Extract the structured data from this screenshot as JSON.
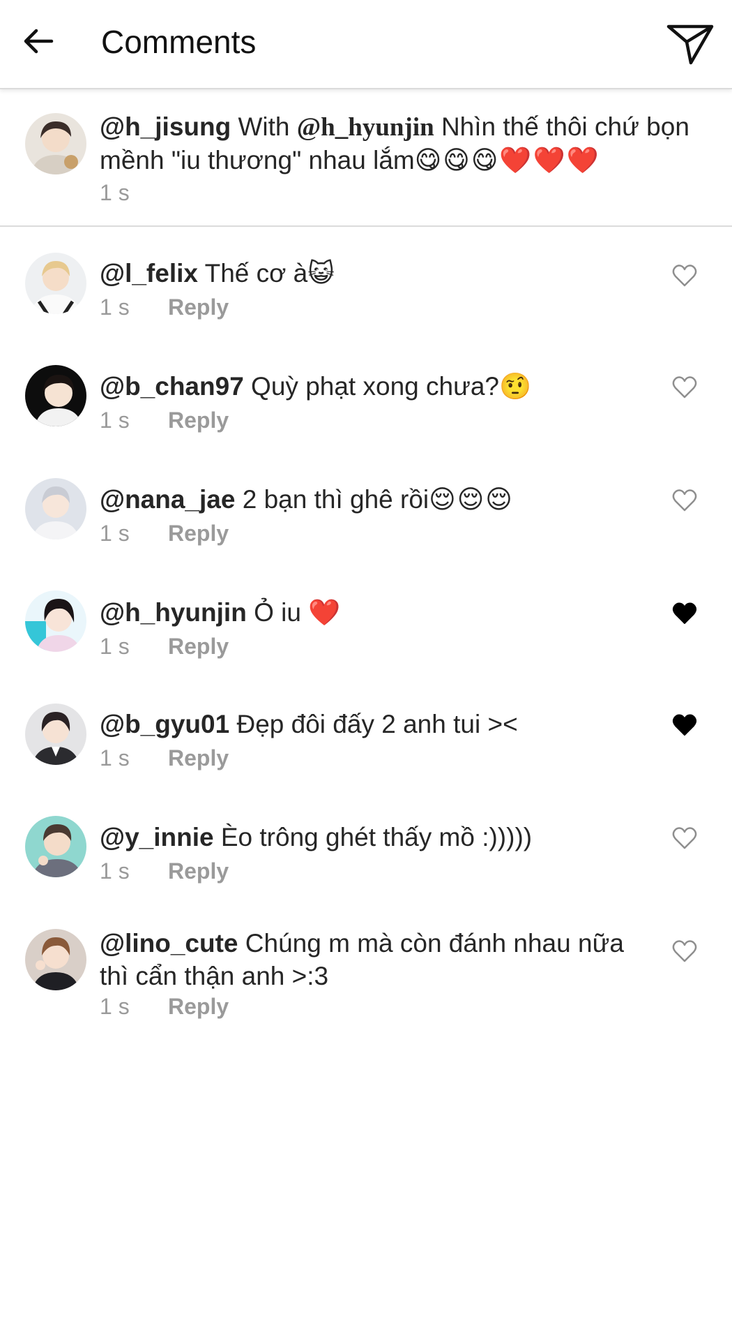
{
  "header": {
    "title": "Comments"
  },
  "caption": {
    "username": "@h_jisung",
    "text_before": " With ",
    "mention": "@h_hyunjin",
    "text_after": " Nhìn thế thôi chứ bọn mềnh \"iu thương\" nhau lắm",
    "emojis": "😋😋😋❤️❤️❤️",
    "time": "1 s"
  },
  "reply_label": "Reply",
  "comments": [
    {
      "username": "@l_felix",
      "text": " Thế cơ à",
      "emoji": "😺",
      "time": "1 s",
      "liked": false
    },
    {
      "username": "@b_chan97",
      "text": " Quỳ phạt xong chưa?",
      "emoji": "🤨",
      "time": "1 s",
      "liked": false
    },
    {
      "username": "@nana_jae",
      "text": " 2 bạn thì ghê rồi",
      "emoji": "😌😌😌",
      "time": "1 s",
      "liked": false
    },
    {
      "username": "@h_hyunjin",
      "text": " Ỏ iu ",
      "emoji": "❤️",
      "time": "1 s",
      "liked": true
    },
    {
      "username": "@b_gyu01",
      "text": " Đẹp đôi đấy 2 anh tui ><",
      "emoji": "",
      "time": "1 s",
      "liked": true
    },
    {
      "username": "@y_innie",
      "text": " Èo trông ghét thấy mồ :)))))",
      "emoji": "",
      "time": "1 s",
      "liked": false
    },
    {
      "username": "@lino_cute",
      "text": " Chúng m mà còn đánh nhau nữa thì cẩn thận anh >:3",
      "emoji": "",
      "time": "1 s",
      "liked": false
    }
  ],
  "colors": {
    "text": "#262626",
    "meta": "#9a9a9a",
    "divider": "#dbdbdb",
    "heart_outline": "#8e8e8e",
    "heart_filled": "#000000"
  },
  "icons": [
    "back-arrow-icon",
    "send-icon",
    "heart-outline-icon",
    "heart-filled-icon"
  ]
}
